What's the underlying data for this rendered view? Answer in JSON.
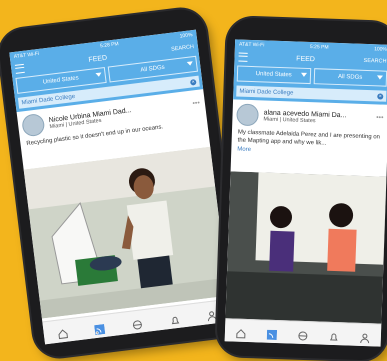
{
  "left": {
    "status": {
      "carrier": "AT&T Wi-Fi",
      "time": "5:28 PM",
      "battery": "100%"
    },
    "title": "FEED",
    "search": "SEARCH",
    "country": "United States",
    "sdgs": "All SDGs",
    "college": "Miami Dade College",
    "post": {
      "name": "Nicole Urbina Miami Dad...",
      "location": "Miami | United States",
      "text": "Recycling plastic so it doesn't end up in our oceans."
    }
  },
  "right": {
    "status": {
      "carrier": "AT&T Wi-Fi",
      "time": "5:25 PM",
      "battery": "100%"
    },
    "title": "FEED",
    "search": "SEARCH",
    "country": "United States",
    "sdgs": "All SDGs",
    "college": "Miami Dade College",
    "post": {
      "name": "alana acevedo Miami Da...",
      "location": "Miami | United States",
      "text": "My classmate Adelaida Perez and I are presenting on the Mapting app and why we lik...",
      "more": "More"
    }
  }
}
